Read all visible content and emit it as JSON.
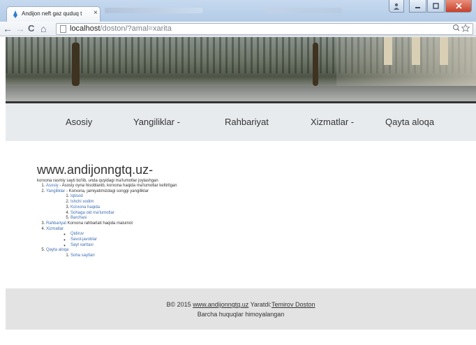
{
  "browser": {
    "tab_title": "Andijon neft gaz quduq t",
    "tab_close": "×",
    "url_host": "localhost",
    "url_path": "/doston/?amal=xarita"
  },
  "nav": {
    "items": [
      "Asosiy",
      "Yangiliklar -",
      "Rahbariyat",
      "Xizmatlar -",
      "Qayta aloqa"
    ]
  },
  "main": {
    "title": "www.andijonngtq.uz-",
    "intro": "korxona rasmiy sayti bo'lib, unda quyidagi ma'lumotlar joylashgan",
    "sections": [
      {
        "link": "Asosiy",
        "desc": " - Asosiy oyna hisoblanib, korxona haqida ma'lumotlar keltirilgan"
      },
      {
        "link": "Yangiliklar",
        "desc": " - Korxona, jamiyatimizdagi songgi yangiliklar",
        "children": [
          "Iqtisod",
          "Ishchi xodim",
          "Korxona haqida",
          "Sohaga oid ma'lumotlar",
          "Barchasi"
        ]
      },
      {
        "link": "Rahbariyat",
        "desc": " Korxona rahbarlati haqida malumot"
      },
      {
        "link": "Xizmatlar",
        "desc": "",
        "children": [
          "Qidiruv",
          "Savol-javoblar",
          "Sayt xaritasi"
        ]
      },
      {
        "link": "Qayta aloqa",
        "desc": "",
        "children": [
          "Soha saytlari"
        ]
      }
    ]
  },
  "footer": {
    "prefix": "B© 2015 ",
    "site_link": "www.andijonngtq.uz",
    "made_by": " Yaratdi:",
    "author": "Temirov Doston",
    "rights": "Barcha huquqlar himoyalangan"
  },
  "colors": {
    "link": "#3f6fb5",
    "navbar_bg": "#e8ebee",
    "footer_bg": "#e3e3e3"
  }
}
